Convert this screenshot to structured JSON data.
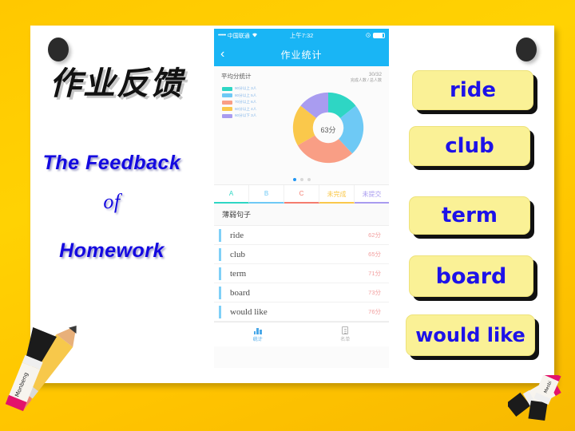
{
  "slide": {
    "title_cn": "作业反馈",
    "title_en_line1": "The Feedback",
    "title_en_line2": "of",
    "title_en_line3": "Homework",
    "background_color": "#FFC800",
    "board_color": "#FFFFFF"
  },
  "phone": {
    "statusbar": {
      "signal_dots": "•••••",
      "carrier": "中国联通",
      "wifi_icon": "wifi-icon",
      "time": "上午7:32",
      "alarm_icon": "alarm-icon",
      "battery_icon": "battery-icon"
    },
    "navbar": {
      "back_icon": "chevron-left-icon",
      "title": "作业统计"
    },
    "stats": {
      "section_label": "平均分统计",
      "ratio_value": "30/32",
      "ratio_caption": "完成人数 / 总人数",
      "donut_center": "63分",
      "legend": [
        {
          "label": "90分以上 3人",
          "color": "#2ED6C4"
        },
        {
          "label": "80分以上 5人",
          "color": "#6EC9F5"
        },
        {
          "label": "70分以上 6人",
          "color": "#F99E85"
        },
        {
          "label": "60分以上 4人",
          "color": "#FAC84B"
        },
        {
          "label": "60分以下 3人",
          "color": "#A99CF0"
        }
      ],
      "pager_dots": 3,
      "pager_active": 0
    },
    "tabs": [
      {
        "label": "A",
        "color": "#2ED6C4"
      },
      {
        "label": "B",
        "color": "#6EC9F5"
      },
      {
        "label": "C",
        "color": "#F47C6E"
      },
      {
        "label": "未完成",
        "color": "#FAC84B"
      },
      {
        "label": "未提交",
        "color": "#A99CF0"
      }
    ],
    "list_heading": "薄弱句子",
    "words": [
      {
        "word": "ride",
        "score": "62分"
      },
      {
        "word": "club",
        "score": "65分"
      },
      {
        "word": "term",
        "score": "71分"
      },
      {
        "word": "board",
        "score": "73分"
      },
      {
        "word": "would like",
        "score": "76分"
      }
    ],
    "bottom_nav": [
      {
        "label": "统计",
        "icon": "bar-chart-icon",
        "active": true
      },
      {
        "label": "名单",
        "icon": "document-icon",
        "active": false
      }
    ]
  },
  "cards": [
    {
      "text": "ride"
    },
    {
      "text": "club"
    },
    {
      "text": "term"
    },
    {
      "text": "board"
    },
    {
      "text": "would like"
    }
  ],
  "chart_data": {
    "type": "pie",
    "title": "平均分统计",
    "center_label": "63分",
    "categories": [
      "90分以上 3人",
      "80分以上 5人",
      "70分以上 6人",
      "60分以上 4人",
      "60分以下 3人"
    ],
    "values": [
      3,
      5,
      6,
      4,
      3
    ],
    "colors": [
      "#2ED6C4",
      "#6EC9F5",
      "#F99E85",
      "#FAC84B",
      "#A99CF0"
    ],
    "legend_position": "left",
    "donut": true
  }
}
